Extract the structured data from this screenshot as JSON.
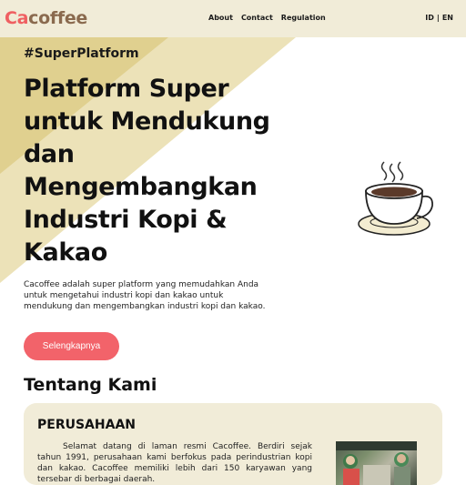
{
  "header": {
    "logo_part1": "Ca",
    "logo_part2": "coffee",
    "nav": [
      "About",
      "Contact",
      "Regulation"
    ],
    "lang_id": "ID",
    "lang_sep": "|",
    "lang_en": "EN"
  },
  "hero": {
    "hashtag": "#SuperPlatform",
    "headline": "Platform Super untuk Mendukung dan Mengembangkan Industri Kopi & Kakao",
    "description": "Cacoffee adalah super platform yang memudahkan Anda untuk mengetahui industri kopi dan kakao untuk mendukung dan mengembangkan industri kopi dan kakao.",
    "cta_label": "Selengkapnya"
  },
  "about": {
    "title": "Tentang Kami",
    "card_title": "PERUSAHAAN",
    "card_text": "Selamat datang di laman resmi Cacoffee. Berdiri sejak tahun 1991, perusahaan kami berfokus pada perindustrian kopi dan kakao. Cacoffee memiliki lebih dari 150 karyawan yang tersebar di berbagai daerah."
  },
  "colors": {
    "header_bg": "#f1ecd8",
    "accent": "#f2636a",
    "logo_brown": "#8a6a4e",
    "hero_shape": "#e8dca6"
  },
  "icons": [
    "coffee-cup-icon"
  ]
}
